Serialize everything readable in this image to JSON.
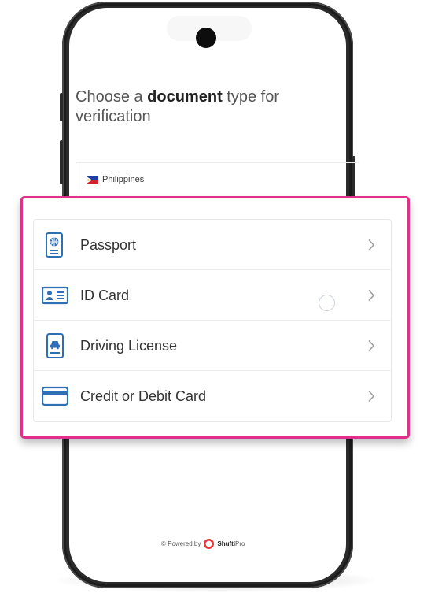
{
  "heading": {
    "prefix": "Choose a ",
    "bold": "document",
    "suffix": " type for verification"
  },
  "country": {
    "name": "Philippines",
    "flag_icon": "philippines-flag-icon"
  },
  "document_types": [
    {
      "label": "Passport",
      "icon": "passport-icon"
    },
    {
      "label": "ID Card",
      "icon": "id-card-icon"
    },
    {
      "label": "Driving License",
      "icon": "driving-license-icon"
    },
    {
      "label": "Credit or Debit Card",
      "icon": "credit-card-icon"
    }
  ],
  "footer": {
    "powered_by": "© Powered by",
    "brand_bold": "Shufti",
    "brand_light": "Pro"
  },
  "colors": {
    "highlight_border": "#e0308a",
    "icon_blue": "#2f6fb5",
    "brand_red": "#e8363c"
  }
}
